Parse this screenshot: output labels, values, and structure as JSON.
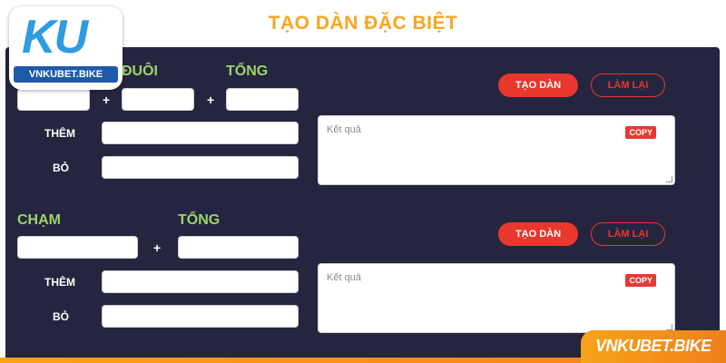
{
  "page": {
    "title": "TẠO DÀN ĐẶC BIỆT"
  },
  "section1": {
    "label_duoi": "ĐUÔI",
    "label_tong": "TỔNG",
    "plus": "+",
    "label_them": "THÊM",
    "label_bo": "BỎ",
    "result_placeholder": "Kết quả",
    "copy_label": "COPY",
    "create_label": "TẠO DÀN",
    "reset_label": "LÀM LẠI"
  },
  "section2": {
    "label_cham": "CHẠM",
    "label_tong": "TỔNG",
    "plus": "+",
    "label_them": "THÊM",
    "label_bo": "BỎ",
    "result_placeholder": "Kết quả",
    "copy_label": "COPY",
    "create_label": "TẠO DÀN",
    "reset_label": "LÀM LẠI"
  },
  "logo": {
    "mark": "KU",
    "site": "VNKUBET.BIKE"
  },
  "banner": {
    "text": "VNKUBET.BIKE"
  },
  "colors": {
    "title": "#f5a623",
    "panel": "#25253f",
    "label_green": "#9ed36a",
    "button_red": "#e8372c",
    "banner_orange": "#f7a21b"
  }
}
